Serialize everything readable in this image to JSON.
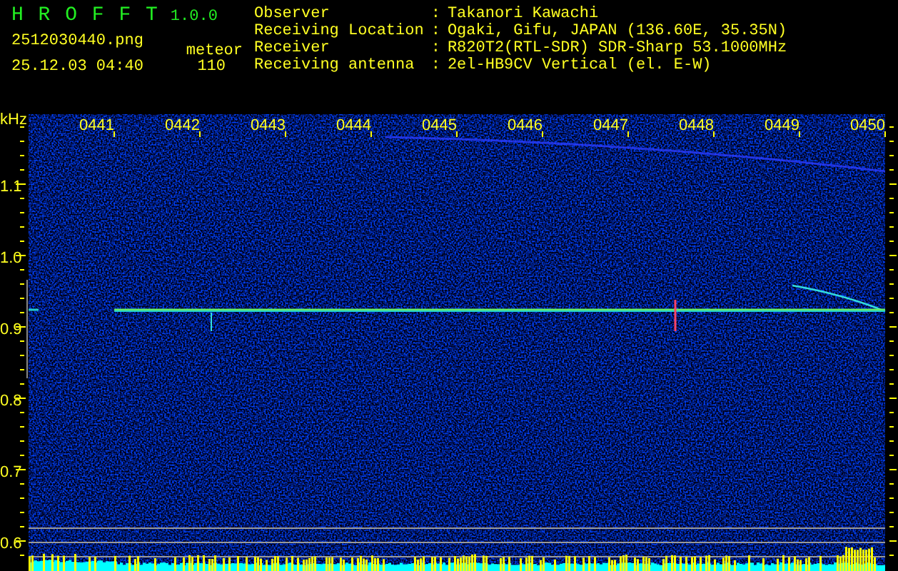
{
  "app": {
    "title": "H R O F F T",
    "version": "1.0.0"
  },
  "file": {
    "name": "2512030440.png",
    "datetime": "25.12.03 04:40"
  },
  "counter": {
    "label": "meteor",
    "value": "110"
  },
  "station_info": {
    "separator": ":",
    "rows": [
      {
        "label": "Observer",
        "value": "Takanori Kawachi"
      },
      {
        "label": "Receiving Location",
        "value": "Ogaki, Gifu, JAPAN (136.60E, 35.35N)"
      },
      {
        "label": "Receiver",
        "value": "R820T2(RTL-SDR) SDR-Sharp 53.1000MHz"
      },
      {
        "label": "Receiving antenna",
        "value": "2el-HB9CV Vertical (el. E-W)"
      }
    ]
  },
  "spectrogram": {
    "y_unit": "kHz",
    "y_labels": [
      "1.1",
      "1.0",
      "0.9",
      "0.8",
      "0.7",
      "0.6"
    ],
    "time_labels": [
      "0441",
      "0442",
      "0443",
      "0444",
      "0445",
      "0446",
      "0447",
      "0448",
      "0449",
      "0450"
    ]
  }
}
